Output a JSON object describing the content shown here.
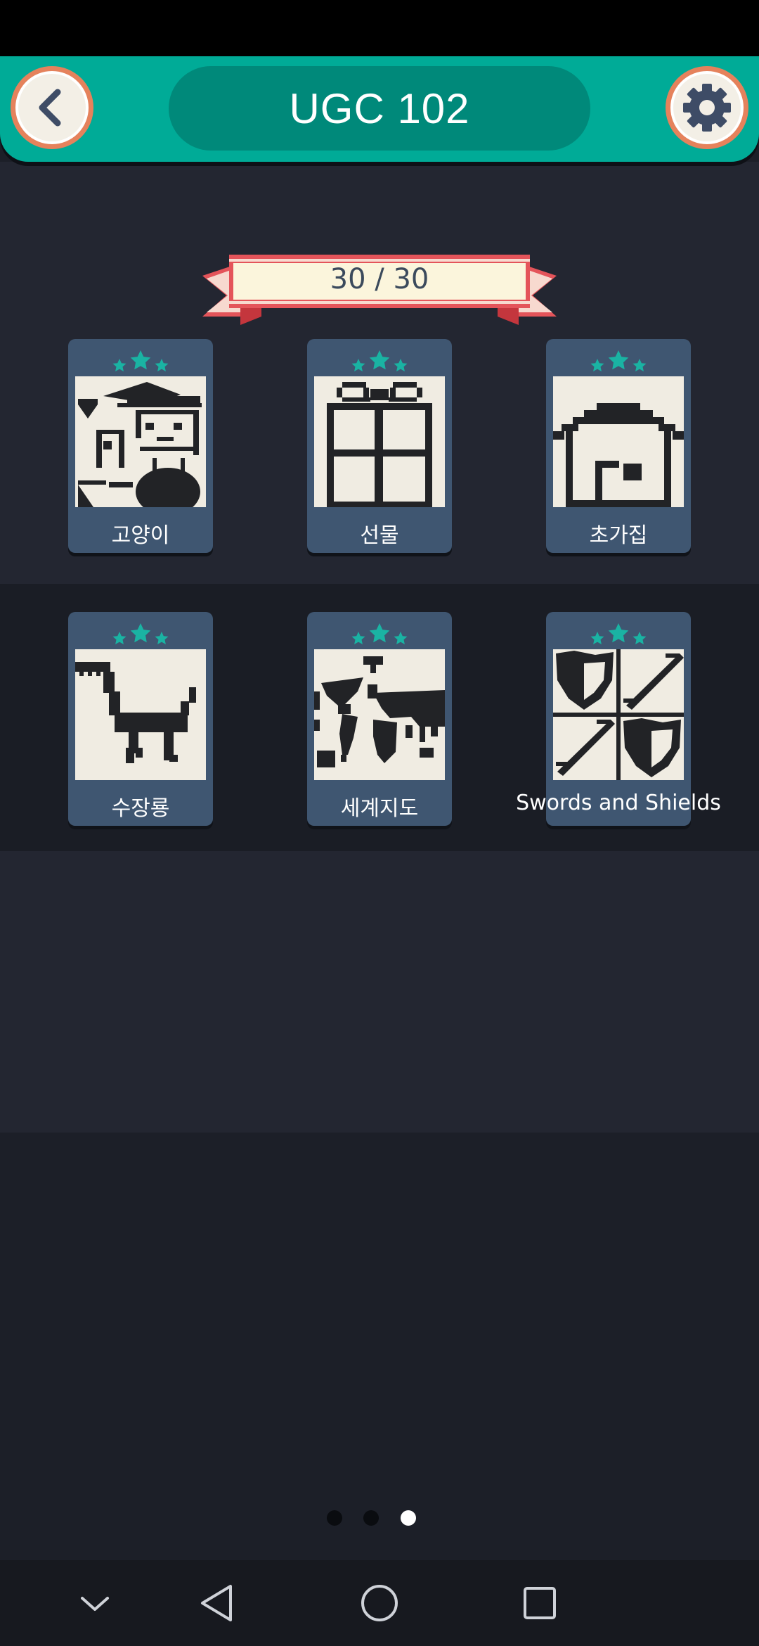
{
  "header": {
    "title": "UGC 102",
    "back_icon": "chevron-left-icon",
    "settings_icon": "gear-icon"
  },
  "progress": {
    "label": "30 / 30"
  },
  "puzzles": [
    {
      "name": "고양이",
      "stars": 3
    },
    {
      "name": "선물",
      "stars": 3
    },
    {
      "name": "초가집",
      "stars": 3
    },
    {
      "name": "수장룡",
      "stars": 3
    },
    {
      "name": "세계지도",
      "stars": 3
    },
    {
      "name": "Swords and Shields",
      "stars": 3
    }
  ],
  "pagination": {
    "pages": 3,
    "current": 3
  },
  "navigation": {
    "icons": [
      "chevron-down-icon",
      "back-triangle-icon",
      "home-circle-icon",
      "recents-square-icon"
    ]
  },
  "colors": {
    "header": "#00ab97",
    "title_pill": "#00897a",
    "button_ring": "#e5825c",
    "star": "#1ab3a3",
    "card": "#3f5671",
    "ribbon_red": "#e4545a",
    "ribbon_cream": "#fbf5dc"
  }
}
